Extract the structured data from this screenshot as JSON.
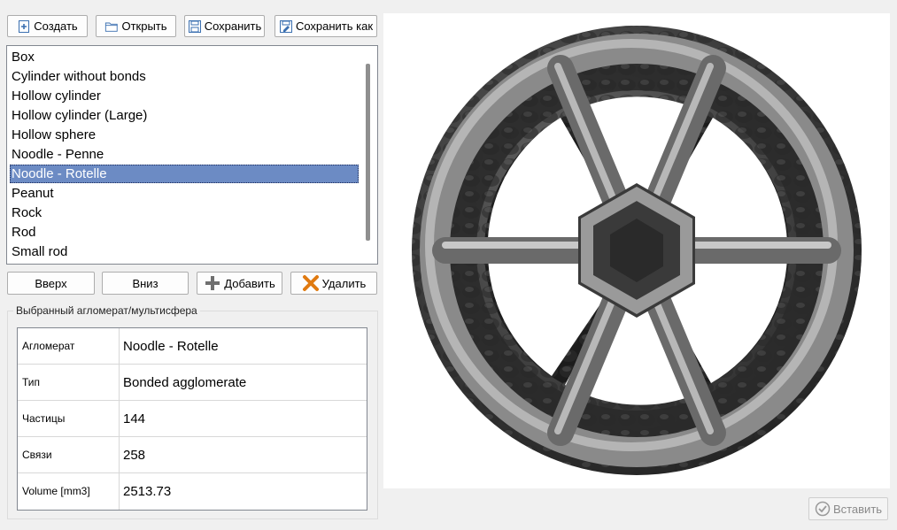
{
  "toolbar": {
    "create_label": "Создать",
    "create_icon": "new-file-icon",
    "open_label": "Открыть",
    "open_icon": "folder-icon",
    "save_label": "Сохранить",
    "save_icon": "floppy-disk-icon",
    "save_as_label": "Сохранить как",
    "save_as_icon": "save-as-icon"
  },
  "list": {
    "items": [
      "Box",
      "Cylinder without bonds",
      "Hollow cylinder",
      "Hollow cylinder (Large)",
      "Hollow sphere",
      "Noodle - Penne",
      "Noodle - Rotelle",
      "Peanut",
      "Rock",
      "Rod",
      "Small rod"
    ],
    "selected": "Noodle - Rotelle"
  },
  "list_actions": {
    "up_label": "Вверх",
    "down_label": "Вниз",
    "add_label": "Добавить",
    "add_icon": "plus-icon",
    "delete_label": "Удалить",
    "delete_icon": "x-icon"
  },
  "details": {
    "group_title": "Выбранный агломерат/мультисфера",
    "rows": [
      {
        "key": "Агломерат",
        "value": "Noodle - Rotelle"
      },
      {
        "key": "Тип",
        "value": "Bonded agglomerate"
      },
      {
        "key": "Частицы",
        "value": "144"
      },
      {
        "key": "Связи",
        "value": "258"
      },
      {
        "key": "Volume [mm3]",
        "value": "2513.73"
      }
    ]
  },
  "footer": {
    "insert_label": "Вставить",
    "insert_icon": "check-circle-icon",
    "insert_enabled": false
  },
  "colors": {
    "selection": "#6c8bc4",
    "window_bg": "#f0f0f0",
    "viewport_bg": "#ffffff",
    "model_gray": "#8c8c8c"
  }
}
